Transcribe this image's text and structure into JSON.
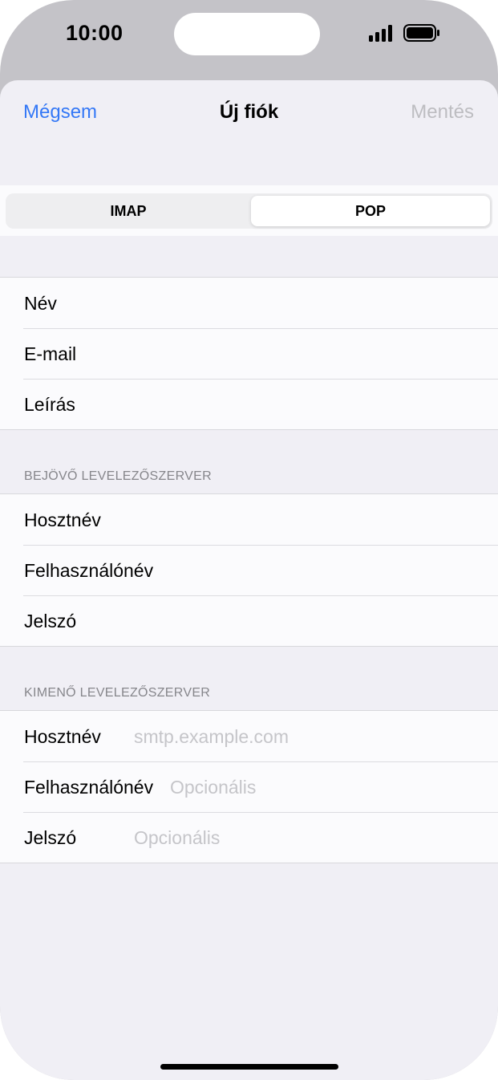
{
  "status": {
    "time": "10:00"
  },
  "nav": {
    "cancel": "Mégsem",
    "title": "Új fiók",
    "save": "Mentés"
  },
  "segmented": {
    "options": [
      "IMAP",
      "POP"
    ],
    "selected": "POP"
  },
  "account": {
    "rows": [
      {
        "label": "Név"
      },
      {
        "label": "E-mail"
      },
      {
        "label": "Leírás"
      }
    ]
  },
  "incoming": {
    "header": "BEJÖVŐ LEVELEZŐSZERVER",
    "rows": [
      {
        "label": "Hosztnév"
      },
      {
        "label": "Felhasználónév"
      },
      {
        "label": "Jelszó"
      }
    ]
  },
  "outgoing": {
    "header": "KIMENŐ LEVELEZŐSZERVER",
    "rows": [
      {
        "label": "Hosztnév",
        "placeholder": "smtp.example.com"
      },
      {
        "label": "Felhasználónév",
        "placeholder": "Opcionális"
      },
      {
        "label": "Jelszó",
        "placeholder": "Opcionális"
      }
    ]
  },
  "colors": {
    "accent": "#3478f6",
    "disabled": "#bdbdc1",
    "background": "#f0eff5"
  }
}
